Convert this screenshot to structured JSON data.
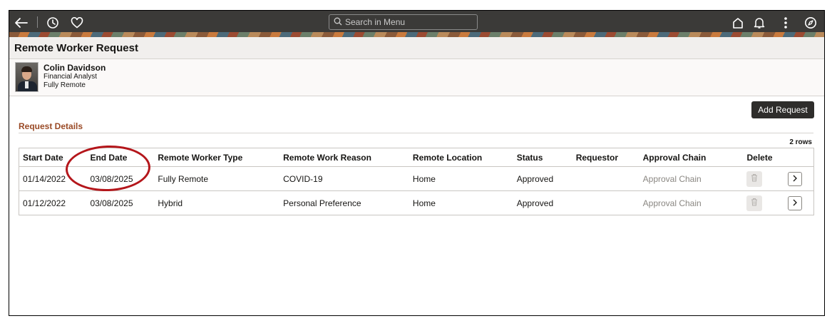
{
  "header": {
    "search_placeholder": "Search in Menu",
    "icons": [
      "back-arrow-icon",
      "history-icon",
      "favorite-heart-icon",
      "home-icon",
      "notifications-bell-icon",
      "more-actions-icon",
      "navigator-compass-icon"
    ]
  },
  "page": {
    "title": "Remote Worker Request"
  },
  "person": {
    "name": "Colin Davidson",
    "job": "Financial Analyst",
    "mode": "Fully Remote"
  },
  "actions": {
    "add_request": "Add Request"
  },
  "section": {
    "title": "Request Details",
    "row_count": "2 rows"
  },
  "table": {
    "headers": {
      "start": "Start Date",
      "end": "End Date",
      "type": "Remote Worker Type",
      "reason": "Remote Work Reason",
      "location": "Remote Location",
      "status": "Status",
      "requestor": "Requestor",
      "approval": "Approval Chain",
      "delete": "Delete"
    },
    "rows": [
      {
        "start": "01/14/2022",
        "end": "03/08/2025",
        "type": "Fully Remote",
        "reason": "COVID-19",
        "location": "Home",
        "status": "Approved",
        "requestor": "",
        "approval": "Approval Chain"
      },
      {
        "start": "01/12/2022",
        "end": "03/08/2025",
        "type": "Hybrid",
        "reason": "Personal Preference",
        "location": "Home",
        "status": "Approved",
        "requestor": "",
        "approval": "Approval Chain"
      }
    ]
  },
  "colors": {
    "accent": "#9a4a26",
    "highlight_oval": "#b4161b",
    "header_bg": "#3b3a38"
  }
}
